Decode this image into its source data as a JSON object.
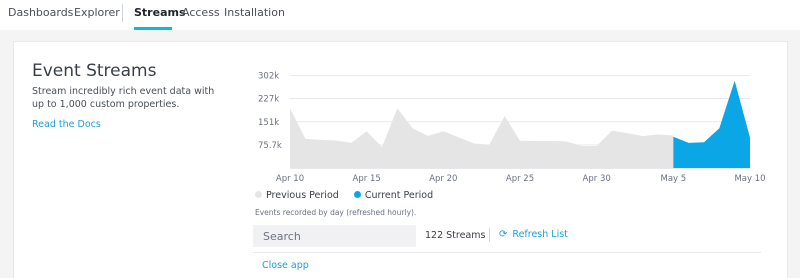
{
  "nav": {
    "items": [
      {
        "label": "Dashboards",
        "active": false
      },
      {
        "label": "Explorer",
        "active": false
      },
      {
        "label": "Streams",
        "active": true
      },
      {
        "label": "Access",
        "active": false
      },
      {
        "label": "Installation",
        "active": false
      }
    ]
  },
  "panel": {
    "title": "Event Streams",
    "description": "Stream incredibly rich event data with up to 1,000 custom properties.",
    "docs_link": "Read the Docs"
  },
  "chart_data": {
    "type": "area",
    "y_ticks": [
      "302k",
      "227k",
      "151k",
      "75.7k"
    ],
    "y_tick_values": [
      302000,
      227000,
      151000,
      75700
    ],
    "ylim": [
      0,
      320000
    ],
    "x_ticks": [
      "Apr 10",
      "Apr 15",
      "Apr 20",
      "Apr 25",
      "Apr 30",
      "May 5",
      "May 10"
    ],
    "grid": true,
    "legend_position": "bottom-left",
    "series": [
      {
        "name": "Previous Period",
        "color": "#e5e5e5",
        "values": [
          196000,
          95000,
          92000,
          90000,
          82000,
          120000,
          68000,
          195000,
          130000,
          105000,
          120000,
          100000,
          80000,
          76000,
          170000,
          89000,
          88000,
          88000,
          87000,
          72000,
          72000,
          122000,
          114000,
          104000,
          110000,
          106000
        ]
      },
      {
        "name": "Current Period",
        "color": "#0ba6e6",
        "values": [
          102000,
          82000,
          84000,
          130000,
          285000,
          99000
        ]
      }
    ]
  },
  "legend": {
    "previous": "Previous Period",
    "current": "Current Period",
    "previous_color": "#e5e5e5",
    "current_color": "#0ba6e6"
  },
  "note": "Events recorded by day (refreshed hourly).",
  "search": {
    "placeholder": "Search"
  },
  "streams": {
    "count_label": "122 Streams",
    "refresh_label": "Refresh List",
    "refresh_icon": "refresh-icon"
  },
  "close_label": "Close app"
}
